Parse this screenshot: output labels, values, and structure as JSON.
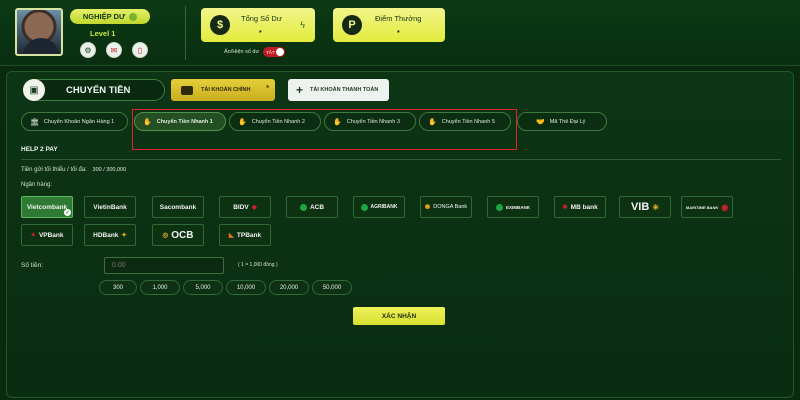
{
  "header": {
    "vip_label": "NGHIỆP DƯ",
    "level": "Level 1",
    "balance": {
      "label": "Tổng Số Dư",
      "value": "*"
    },
    "points": {
      "label": "Điểm Thưởng",
      "value": "*"
    },
    "toggle": {
      "label": "Ẩn/Hiện số dư",
      "state": "TẮT"
    }
  },
  "panel": {
    "title": "CHUYỂN TIỀN",
    "accounts": {
      "main_label": "TÀI KHOẢN CHÍNH",
      "main_star": "*",
      "pay_label": "TÀI KHOẢN THANH TOÁN"
    },
    "methods": [
      {
        "label": "Chuyển Khoản Ngân Hàng 1"
      },
      {
        "label": "Chuyển Tiền Nhanh 1"
      },
      {
        "label": "Chuyển Tiền Nhanh 2"
      },
      {
        "label": "Chuyển Tiền Nhanh 3"
      },
      {
        "label": "Chuyển Tiền Nhanh 5"
      },
      {
        "label": "Mã Thẻ Đại Lý"
      }
    ],
    "section_title": "HELP 2 PAY",
    "limit_label": "Tiền gửi tối thiểu / tối đa:",
    "limit_value": "300 / 300,000",
    "bank_label": "Ngân hàng:",
    "banks": [
      {
        "name": "Vietcombank"
      },
      {
        "name": "VietinBank"
      },
      {
        "name": "Sacombank"
      },
      {
        "name": "BIDV"
      },
      {
        "name": "ACB"
      },
      {
        "name": "AGRIBANK"
      },
      {
        "name": "DONGA Bank"
      },
      {
        "name": "EXIMBANK"
      },
      {
        "name": "MB bank"
      },
      {
        "name": "VIB"
      },
      {
        "name": "MARITIME BANK"
      },
      {
        "name": "VPBank"
      },
      {
        "name": "HDBank"
      },
      {
        "name": "OCB"
      },
      {
        "name": "TPBank"
      }
    ],
    "amount_label": "Số tiền:",
    "amount_placeholder": "0.00",
    "amount_note": "( 1 = 1,000 đồng )",
    "chips": [
      "300",
      "1,000",
      "5,000",
      "10,000",
      "20,000",
      "50,000"
    ],
    "submit_label": "XÁC NHẬN",
    "colors": {
      "accent": "#e2eb3c",
      "highlight_box": "#e0242c",
      "selected_bank": "#2f7a33"
    }
  }
}
